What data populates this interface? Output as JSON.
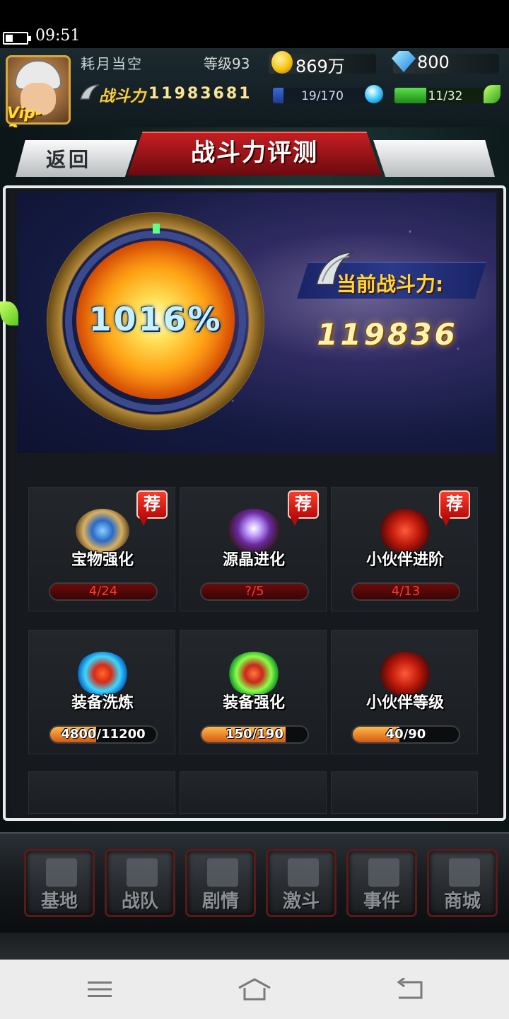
{
  "status_bar": {
    "time": "09:51"
  },
  "player": {
    "name": "耗月当空",
    "level": "等级93",
    "gold": "869万",
    "gems": "800",
    "vip": "Vip-3",
    "power_label": "战斗力",
    "power_value": "11983681",
    "energy_text": "19/170",
    "energy_fraction": 0.11,
    "stamina_text": "11/32",
    "stamina_fraction": 0.34
  },
  "header": {
    "title": "战斗力评测",
    "back_label": "返回"
  },
  "summary": {
    "percent": "1016%",
    "current_label": "当前战斗力:",
    "current_value": "119836"
  },
  "cards": [
    {
      "label": "宝物强化",
      "progress": "4/24",
      "badge": "荐",
      "icon": "treasure-icon"
    },
    {
      "label": "源晶进化",
      "progress": "?/5",
      "badge": "荐",
      "icon": "crystal-icon"
    },
    {
      "label": "小伙伴进阶",
      "progress": "4/13",
      "badge": "荐",
      "icon": "partner-advance-icon"
    },
    {
      "label": "装备洗炼",
      "progress": "4800/11200",
      "fraction": 0.43,
      "icon": "equipment-refine-icon"
    },
    {
      "label": "装备强化",
      "progress": "150/190",
      "fraction": 0.79,
      "icon": "equipment-strength-icon"
    },
    {
      "label": "小伙伴等级",
      "progress": "40/90",
      "fraction": 0.44,
      "icon": "partner-level-icon"
    }
  ],
  "nav": [
    {
      "label": "基地",
      "icon": "base-icon"
    },
    {
      "label": "战队",
      "icon": "team-icon"
    },
    {
      "label": "剧情",
      "icon": "story-icon"
    },
    {
      "label": "激斗",
      "icon": "battle-icon"
    },
    {
      "label": "事件",
      "icon": "event-icon"
    },
    {
      "label": "商城",
      "icon": "shop-icon"
    }
  ],
  "colors": {
    "title_red": "#c51e22",
    "gold": "#f3d04a",
    "progress_red": "#ff3a2a",
    "progress_orange": "#ff9a2a",
    "badge_red": "#e0201a"
  }
}
